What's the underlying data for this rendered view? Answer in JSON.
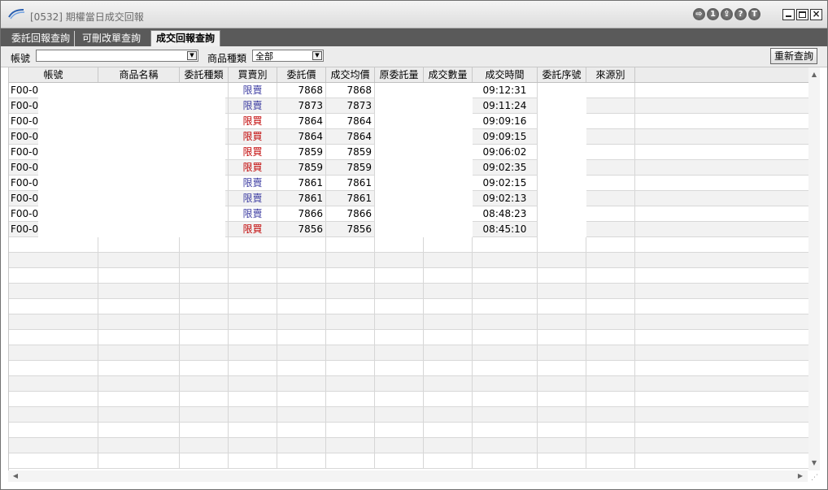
{
  "window": {
    "title": "[0532] 期權當日成交回報"
  },
  "titlebar_icons": [
    {
      "name": "exit-icon",
      "glyph": "⇨"
    },
    {
      "name": "one-icon",
      "glyph": "1"
    },
    {
      "name": "share-icon",
      "glyph": "⇪"
    },
    {
      "name": "help-icon",
      "glyph": "?"
    },
    {
      "name": "t-icon",
      "glyph": "T"
    }
  ],
  "tabs": [
    {
      "label": "委託回報查詢",
      "active": false
    },
    {
      "label": "可刪改單查詢",
      "active": false
    },
    {
      "label": "成交回報查詢",
      "active": true
    }
  ],
  "filters": {
    "account_label": "帳號",
    "account_value": "",
    "product_type_label": "商品種類",
    "product_type_value": "全部",
    "refresh_label": "重新查詢"
  },
  "columns": [
    "帳號",
    "商品名稱",
    "委託種類",
    "買賣別",
    "委託價",
    "成交均價",
    "原委託量",
    "成交數量",
    "成交時間",
    "委託序號",
    "來源別"
  ],
  "rows": [
    {
      "account": "F00-0",
      "side": "限賣",
      "side_type": "sell",
      "price": "7868",
      "avg": "7868",
      "time": "09:12:31"
    },
    {
      "account": "F00-0",
      "side": "限賣",
      "side_type": "sell",
      "price": "7873",
      "avg": "7873",
      "time": "09:11:24"
    },
    {
      "account": "F00-0",
      "side": "限買",
      "side_type": "buy",
      "price": "7864",
      "avg": "7864",
      "time": "09:09:16"
    },
    {
      "account": "F00-0",
      "side": "限買",
      "side_type": "buy",
      "price": "7864",
      "avg": "7864",
      "time": "09:09:15"
    },
    {
      "account": "F00-0",
      "side": "限買",
      "side_type": "buy",
      "price": "7859",
      "avg": "7859",
      "time": "09:06:02"
    },
    {
      "account": "F00-0",
      "side": "限買",
      "side_type": "buy",
      "price": "7859",
      "avg": "7859",
      "time": "09:02:35"
    },
    {
      "account": "F00-0",
      "side": "限賣",
      "side_type": "sell",
      "price": "7861",
      "avg": "7861",
      "time": "09:02:15"
    },
    {
      "account": "F00-0",
      "side": "限賣",
      "side_type": "sell",
      "price": "7861",
      "avg": "7861",
      "time": "09:02:13"
    },
    {
      "account": "F00-0",
      "side": "限賣",
      "side_type": "sell",
      "price": "7866",
      "avg": "7866",
      "time": "08:48:23"
    },
    {
      "account": "F00-0",
      "side": "限買",
      "side_type": "buy",
      "price": "7856",
      "avg": "7856",
      "time": "08:45:10"
    }
  ],
  "colors": {
    "buy": "#c00000",
    "sell": "#3a3aa0",
    "tabbar": "#5a5a5a"
  }
}
